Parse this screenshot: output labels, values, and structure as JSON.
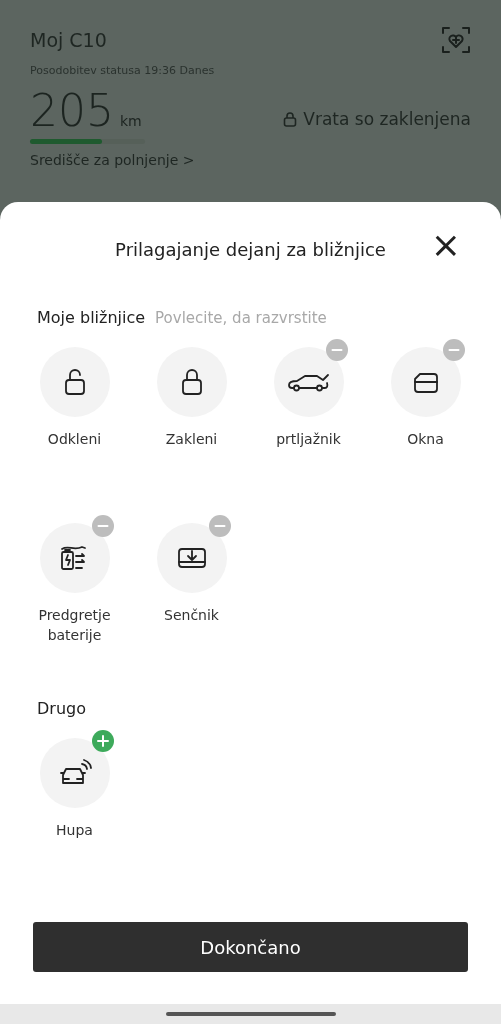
{
  "header": {
    "title": "Moj C10",
    "status": "Posodobitev statusa 19:36 Danes",
    "range": "205",
    "unit": "km",
    "level": 0.63,
    "doors": "Vrata so zaklenjena",
    "charging_link": "Središče za polnjenje",
    "chevron": ">"
  },
  "sheet": {
    "title": "Prilagajanje dejanj za bližnjice",
    "close": "×",
    "my_shortcuts": {
      "label": "Moje bližnjice",
      "hint": "Povlecite, da razvrstite",
      "items": [
        {
          "label": "Odkleni",
          "kind": "unlock",
          "removable": false,
          "addable": false
        },
        {
          "label": "Zakleni",
          "kind": "lock",
          "removable": false,
          "addable": false
        },
        {
          "label": "prtljažnik",
          "kind": "trunk",
          "removable": true,
          "addable": false
        },
        {
          "label": "Okna",
          "kind": "window",
          "removable": true,
          "addable": false
        },
        {
          "label": "Predgretje baterije",
          "kind": "battery",
          "removable": true,
          "addable": false
        },
        {
          "label": "Senčnik",
          "kind": "shade",
          "removable": true,
          "addable": false
        }
      ]
    },
    "other": {
      "label": "Drugo",
      "items": [
        {
          "label": "Hupa",
          "kind": "horn",
          "removable": false,
          "addable": true
        }
      ]
    },
    "done": "Dokončano"
  }
}
